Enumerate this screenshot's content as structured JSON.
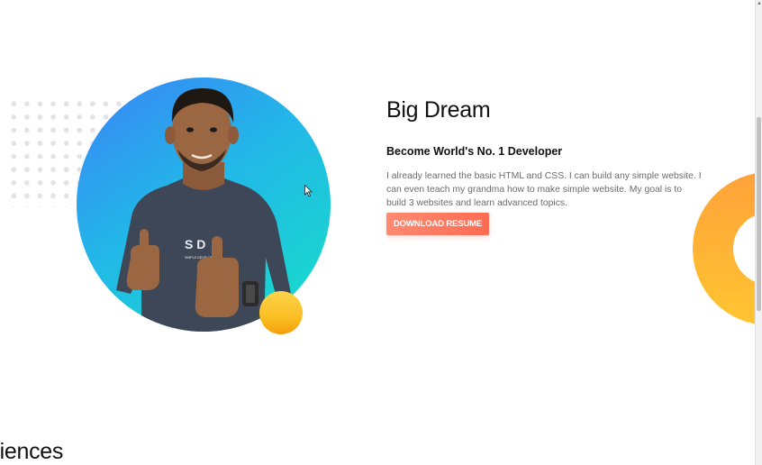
{
  "hero": {
    "title": "Big Dream",
    "subtitle": "Become World's No. 1 Developer",
    "description": "I already learned the basic HTML and CSS. I can build any simple website. I can even teach my grandma how to make simple website. My goal is to build 3 websites and learn advanced topics.",
    "cta_label": "DOWNLOAD RESUME",
    "shirt_logo_top": "S D",
    "shirt_logo_sub": "SIMPLE DEVELOPER"
  },
  "next_section": {
    "heading": "eriences"
  },
  "colors": {
    "accent": "#ff6b52",
    "circle_start": "#3b82f6",
    "circle_end": "#17e0c8",
    "orb": "#fbbf24",
    "ring": "#ffb236"
  },
  "icons": {
    "cursor": "arrow-cursor-icon",
    "scroll_up": "chevron-up-icon"
  }
}
